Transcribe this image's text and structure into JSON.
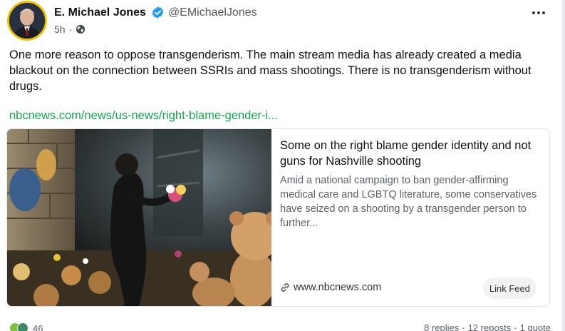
{
  "author": {
    "display_name": "E. Michael Jones",
    "handle": "@EMichaelJones",
    "verified": true,
    "avatar_icon": "avatar-photo",
    "timestamp": "5h",
    "separator": "·",
    "visibility_icon": "globe-icon"
  },
  "post": {
    "text": "One more reason to oppose transgenderism. The main stream media has already created a media blackout on the connection between SSRIs and mass shootings. There is no transgenderism without drugs.",
    "link": "nbcnews.com/news/us-news/right-blame-gender-i...",
    "link_color": "#15a54a"
  },
  "card": {
    "title": "Some on the right blame gender identity and not guns for Nashville shooting",
    "description": "Amid a national campaign to ban gender-affirming medical care and LGBTQ literature, some conservatives have seized on a shooting by a transgender person to further...",
    "domain": "www.nbcnews.com",
    "link_feed_label": "Link Feed",
    "image_icon": "memorial-photo"
  },
  "stats": {
    "reaction_count": "46",
    "replies": "8 replies",
    "reposts": "12 reposts",
    "quotes": "1 quote",
    "separator": "·"
  },
  "colors": {
    "accent_green": "#15a54a",
    "verified_blue": "#1d9bf0",
    "avatar_ring": "#f2c300"
  }
}
